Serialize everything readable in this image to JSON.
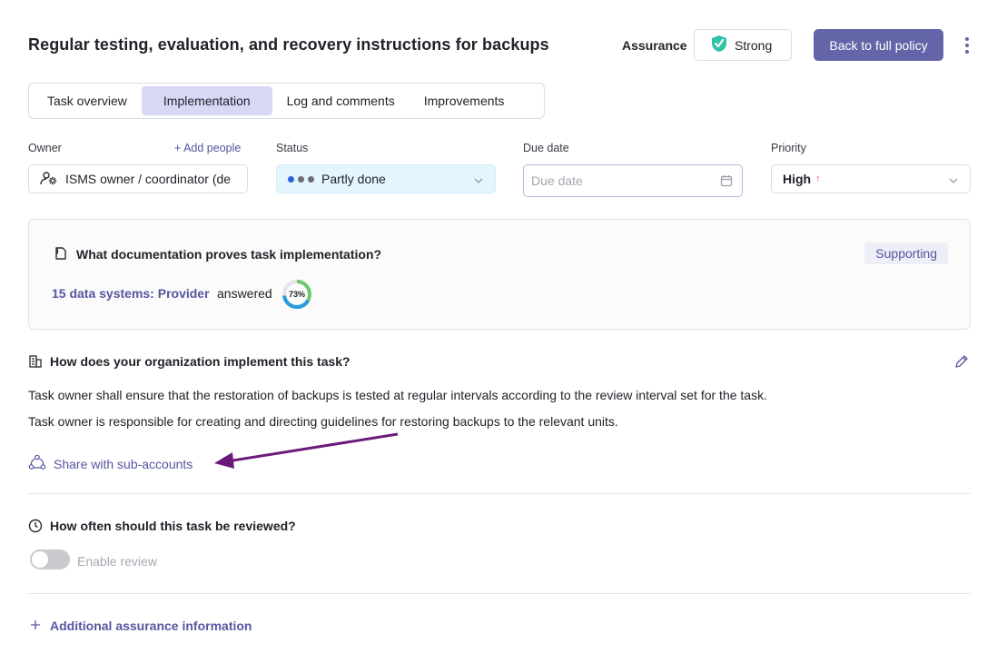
{
  "header": {
    "title": "Regular testing, evaluation, and recovery instructions for backups",
    "assurance_label": "Assurance",
    "assurance_value": "Strong",
    "assurance_color": "#2fc3a8",
    "back_button": "Back to full policy",
    "menu_icon": "kebab-menu-icon"
  },
  "tabs": [
    {
      "label": "Task overview",
      "active": false
    },
    {
      "label": "Implementation",
      "active": true
    },
    {
      "label": "Log and comments",
      "active": false
    },
    {
      "label": "Improvements",
      "active": false
    }
  ],
  "fields": {
    "owner_label": "Owner",
    "add_people": "+ Add people",
    "owner_value": "ISMS owner / coordinator (de",
    "status_label": "Status",
    "status_value": "Partly done",
    "status_dot_colors": [
      "#2f5fe0",
      "#6c6c74",
      "#6c6c74"
    ],
    "due_label": "Due date",
    "due_placeholder": "Due date",
    "priority_label": "Priority",
    "priority_value": "High",
    "priority_arrow": "↑",
    "priority_arrow_color": "#e05555"
  },
  "documentation": {
    "question": "What documentation proves task implementation?",
    "badge": "Supporting",
    "link": "15 data systems: Provider",
    "answered": "answered",
    "progress_percent": 73,
    "progress_label": "73%"
  },
  "implementation": {
    "question": "How does your organization implement this task?",
    "line1": "Task owner shall ensure that the restoration of backups is tested at regular intervals according to the review interval set for the task.",
    "line2": "Task owner is responsible for creating and directing guidelines for restoring backups to the relevant units.",
    "share": "Share with sub-accounts"
  },
  "review": {
    "question": "How often should this task be reviewed?",
    "toggle_label": "Enable review",
    "enabled": false
  },
  "additional": {
    "label": "Additional assurance information"
  },
  "colors": {
    "accent": "#6465a8",
    "annotation_arrow": "#6a1b7a"
  }
}
